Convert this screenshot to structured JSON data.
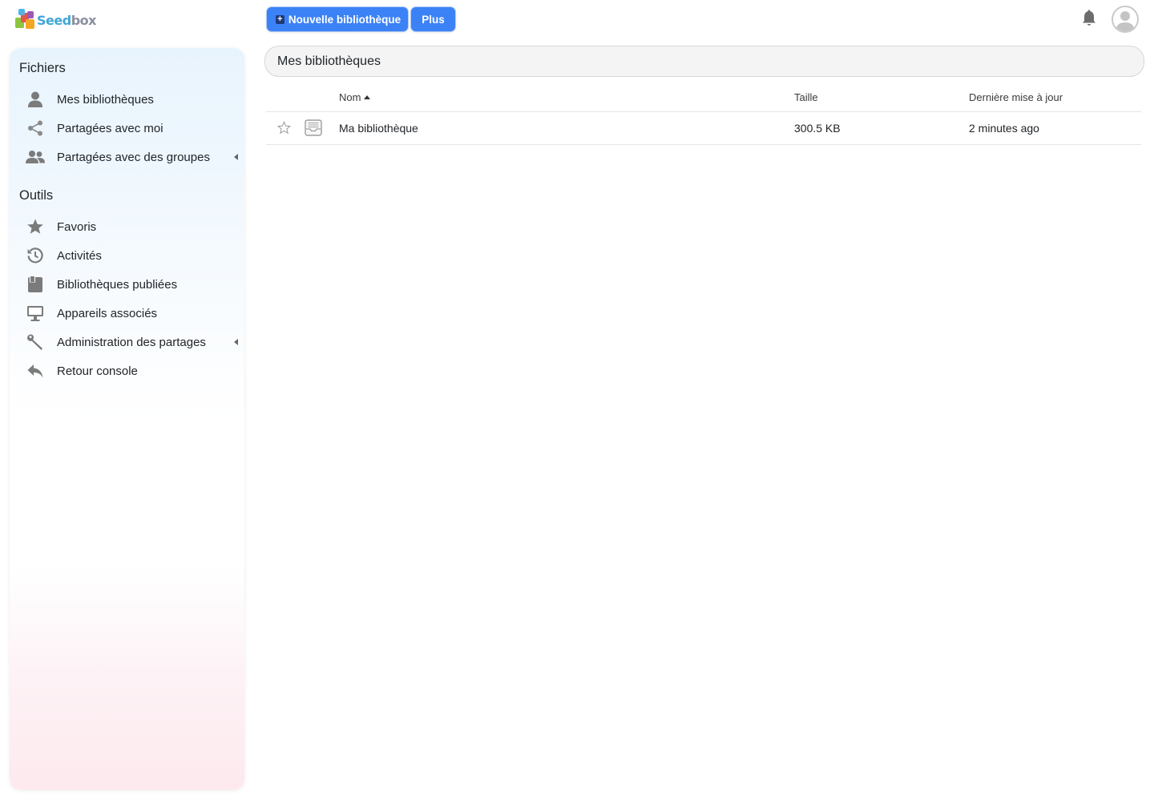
{
  "brand": {
    "logo_text_a": "Seed",
    "logo_text_b": "box"
  },
  "toolbar": {
    "new_library_label": "Nouvelle bibliothèque",
    "more_label": "Plus"
  },
  "header_icons": {
    "notifications": "bell-icon",
    "user": "avatar-icon"
  },
  "sidebar": {
    "files_heading": "Fichiers",
    "files_items": [
      {
        "label": "Mes bibliothèques",
        "icon": "user-icon"
      },
      {
        "label": "Partagées avec moi",
        "icon": "share-icon"
      },
      {
        "label": "Partagées avec des groupes",
        "icon": "group-icon",
        "has_submenu": true
      }
    ],
    "tools_heading": "Outils",
    "tools_items": [
      {
        "label": "Favoris",
        "icon": "star-icon"
      },
      {
        "label": "Activités",
        "icon": "history-icon"
      },
      {
        "label": "Bibliothèques publiées",
        "icon": "published-library-icon"
      },
      {
        "label": "Appareils associés",
        "icon": "monitor-icon"
      },
      {
        "label": "Administration des partages",
        "icon": "wrench-icon",
        "has_submenu": true
      },
      {
        "label": "Retour console",
        "icon": "reply-icon"
      }
    ]
  },
  "main": {
    "path_title": "Mes bibliothèques",
    "columns": {
      "name": "Nom",
      "size": "Taille",
      "updated": "Dernière mise à jour"
    },
    "sort": {
      "column": "name",
      "direction": "asc"
    },
    "rows": [
      {
        "starred": false,
        "icon": "library-icon",
        "name": "Ma bibliothèque",
        "size": "300.5 KB",
        "updated": "2 minutes ago"
      }
    ]
  },
  "colors": {
    "primary_button": "#3b82f6",
    "brand_blue": "#3fa7d6",
    "icon_gray": "#777777"
  }
}
